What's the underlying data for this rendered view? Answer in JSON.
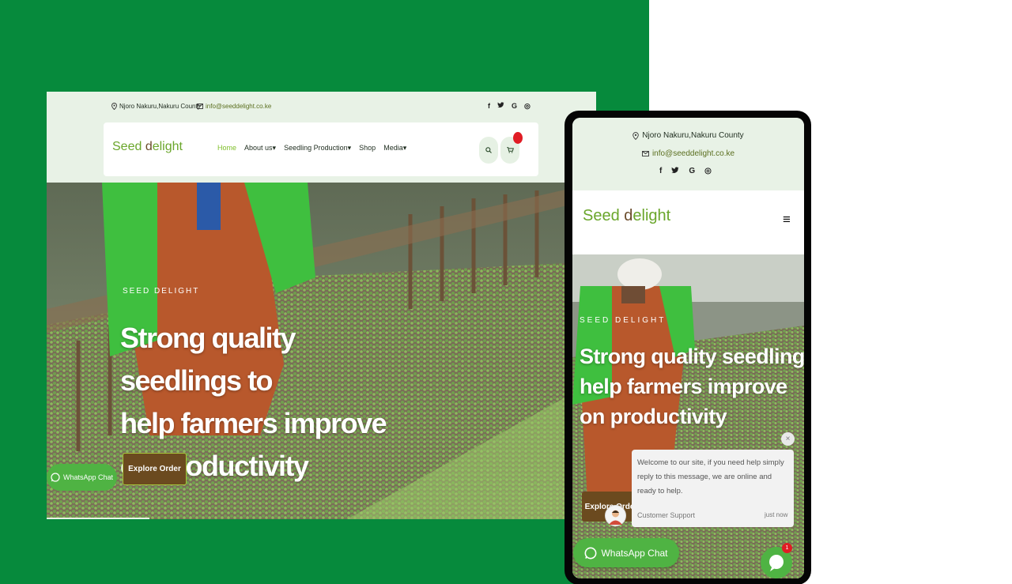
{
  "colors": {
    "green_bg": "#068a3c",
    "brand_green": "#6aa62b",
    "brand_brown": "#6a4b2a",
    "whatsapp": "#4fb343",
    "cta": "#6b4a1f",
    "badge": "#e01c24"
  },
  "desktop": {
    "topbar": {
      "location": "Njoro Nakuru,Nakuru County",
      "email": "info@seeddelight.co.ke",
      "socials": [
        "f",
        "𝕏",
        "G",
        "◎"
      ]
    },
    "logo": {
      "part1": "Seed ",
      "part2": "d",
      "part3": "elight"
    },
    "menu": {
      "home": "Home",
      "about": "About us",
      "seedling": "Seedling Production",
      "shop": "Shop",
      "media": "Media",
      "chevron": "▾"
    },
    "icons": {
      "search": "⌕",
      "cart": "🛒"
    },
    "hero": {
      "kicker": "SEED DELIGHT",
      "title_line1": "Strong quality seedlings to",
      "title_line2": "help farmers improve",
      "title_line3": "on productivity",
      "cta": "Explore Order"
    },
    "whatsapp": "WhatsApp Chat"
  },
  "mobile": {
    "topbar": {
      "location": "Njoro Nakuru,Nakuru County",
      "email": "info@seeddelight.co.ke",
      "socials": [
        "f",
        "𝕏",
        "G",
        "◎"
      ]
    },
    "logo": {
      "part1": "Seed ",
      "part2": "d",
      "part3": "elight"
    },
    "menu_icon": "≡",
    "hero": {
      "kicker": "SEED DELIGHT",
      "title_line1": "Strong quality seedlings to",
      "title_line2": "help farmers improve",
      "title_line3": "on productivity",
      "cta": "Explore Order"
    },
    "popup": {
      "message": "Welcome to our site, if you need help simply reply to this message, we are online and ready to help.",
      "agent": "Customer Support",
      "time": "just now",
      "close": "×"
    },
    "whatsapp": "WhatsApp Chat",
    "chat_badge": "1"
  }
}
